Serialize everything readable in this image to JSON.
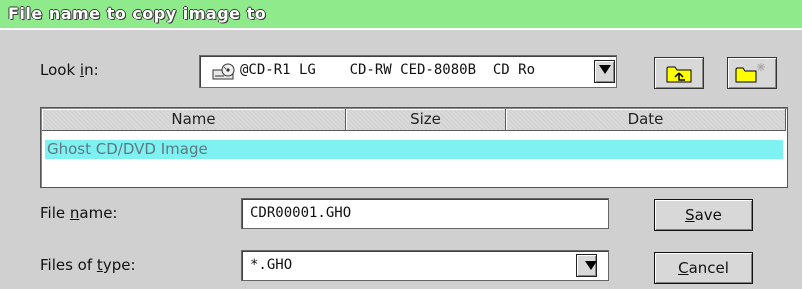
{
  "dialog": {
    "title": "File name to copy image to"
  },
  "lookin": {
    "label_pre": "Look ",
    "label_key": "i",
    "label_post": "n:",
    "value": "@CD-R1 LG    CD-RW CED-8080B  CD Ro",
    "icon": "cd-drive-icon"
  },
  "toolbar": {
    "up_icon": "up-folder-icon",
    "new_icon": "new-folder-icon"
  },
  "list": {
    "columns": [
      "Name",
      "Size",
      "Date"
    ],
    "rows": [
      {
        "name": "Ghost CD/DVD Image"
      }
    ]
  },
  "filename": {
    "label_pre": "File ",
    "label_key": "n",
    "label_post": "ame:",
    "value": "CDR00001.GHO"
  },
  "filetype": {
    "label_pre": "Files of ",
    "label_key": "t",
    "label_post": "ype:",
    "value": "*.GHO"
  },
  "buttons": {
    "save_key": "S",
    "save_rest": "ave",
    "cancel_key": "C",
    "cancel_rest": "ancel"
  },
  "colors": {
    "titlebar": "#8eea8a",
    "selection": "#7ff1f2",
    "dialog_bg": "#cfd0cf"
  }
}
